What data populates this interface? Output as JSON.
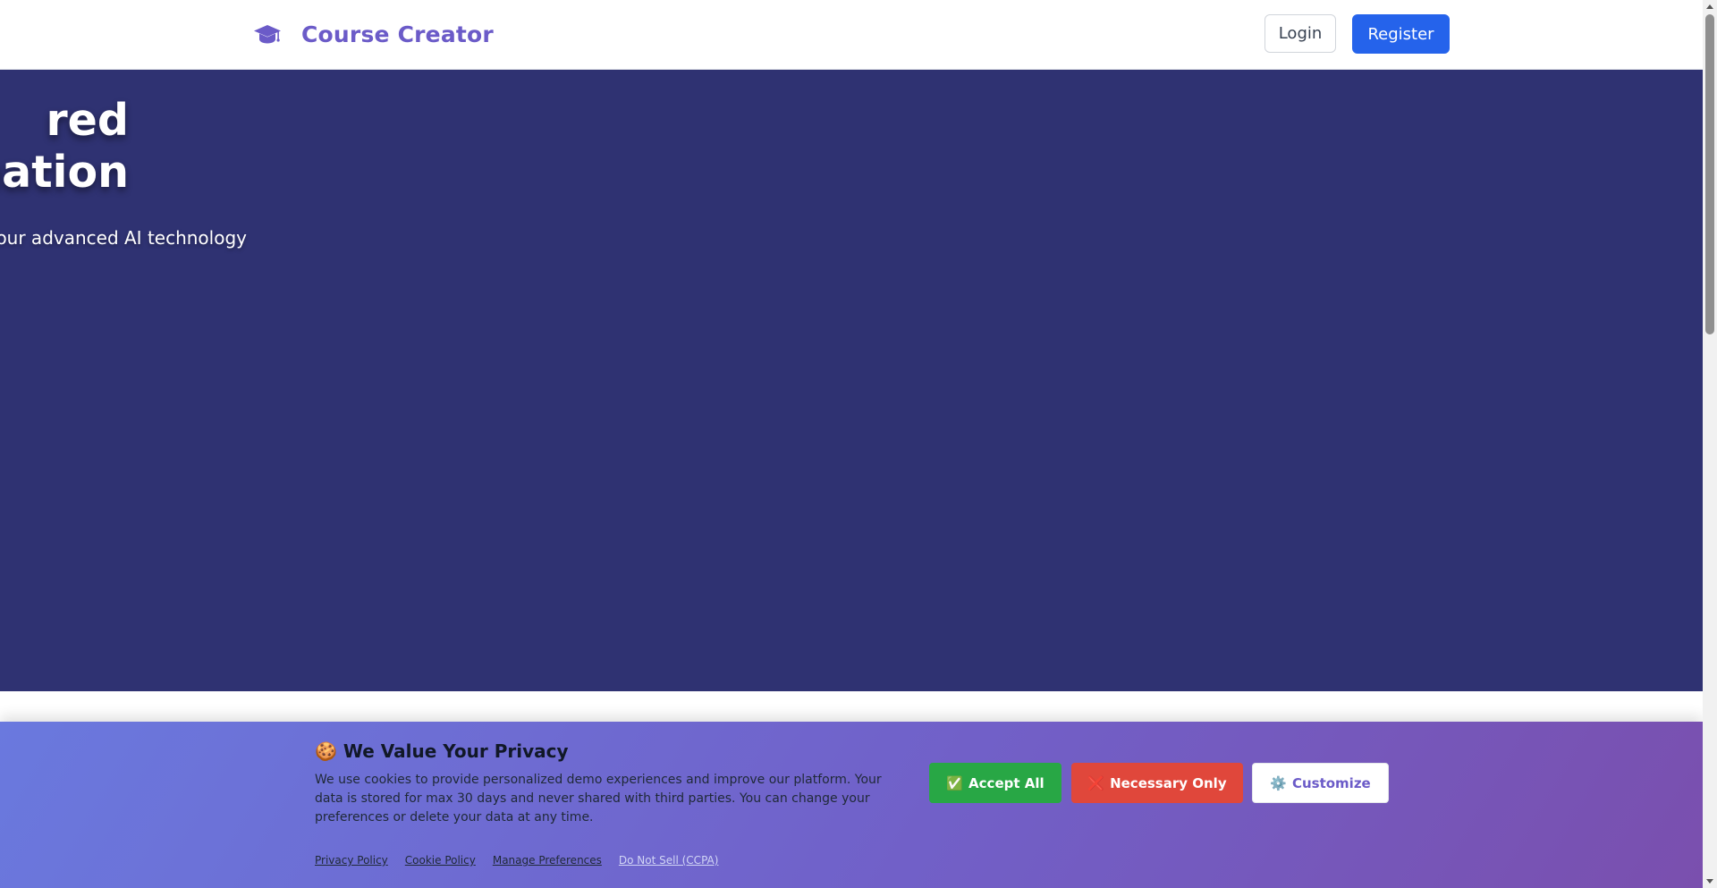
{
  "header": {
    "brand_name": "Course Creator",
    "brand_icon": "graduation-cap-icon",
    "login_label": "Login",
    "register_label": "Register"
  },
  "hero": {
    "title_line1": "red",
    "title_line2": "eation",
    "subtitle": "n our advanced AI technology"
  },
  "cookie_banner": {
    "title": "🍪 We Value Your Privacy",
    "text": "We use cookies to provide personalized demo experiences and improve our platform. Your data is stored for max 30 days and never shared with third parties. You can change your preferences or delete your data at any time.",
    "accept_icon": "✅",
    "accept_label": "Accept All",
    "necessary_icon": "❌",
    "necessary_label": "Necessary Only",
    "customize_icon": "⚙️",
    "customize_label": "Customize",
    "links": [
      "Privacy Policy",
      "Cookie Policy",
      "Manage Preferences",
      "Do Not Sell (CCPA)"
    ]
  },
  "colors": {
    "brand": "#6b5bc8",
    "register": "#2563eb",
    "hero_bg": "#2f3272",
    "accept": "#28a745",
    "necessary": "#e0473b"
  }
}
